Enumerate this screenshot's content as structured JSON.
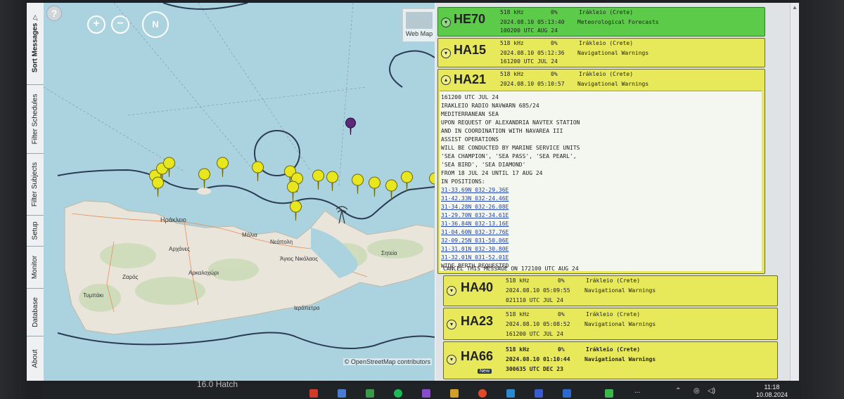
{
  "sidebar": {
    "help_label": "?",
    "tabs": [
      {
        "label": "Sort Messages"
      },
      {
        "label": "Filter Schedules"
      },
      {
        "label": "Filter Subjects"
      },
      {
        "label": "Setup"
      },
      {
        "label": "Monitor"
      },
      {
        "label": "Database"
      },
      {
        "label": "About"
      }
    ]
  },
  "map": {
    "zoom_in": "+",
    "zoom_out": "−",
    "compass": "N",
    "basemap_label": "Web Map",
    "attribution": "© OpenStreetMap contributors",
    "places": {
      "heraklion": "Ηράκλειο",
      "malia": "Μάλια",
      "neapoli": "Νεάπολη",
      "archanes": "Αρχάνες",
      "agios_nikolaos": "Άγιος Νικόλαος",
      "sitia": "Σητεία",
      "arkalochori": "Αρκαλοχώρι",
      "zaros": "Ζαρός",
      "tympaki": "Τυμπάκι",
      "ierapetra": "Ιεράπετρα"
    }
  },
  "messages": [
    {
      "id": "HE70",
      "freq": "518 kHz",
      "pct": "0%",
      "station": "Irákleio (Crete)",
      "datetime": "2024.08.10 05:13:40",
      "subject": "Meteorological Forecasts",
      "ref": "100200 UTC AUG 24",
      "color": "#5dcb4a",
      "expanded": false
    },
    {
      "id": "HA15",
      "freq": "518 kHz",
      "pct": "0%",
      "station": "Irákleio (Crete)",
      "datetime": "2024.08.10 05:12:36",
      "subject": "Navigational Warnings",
      "ref": "161200 UTC JUL 24",
      "color": "#e7e85a",
      "expanded": false
    },
    {
      "id": "HA21",
      "freq": "518 kHz",
      "pct": "0%",
      "station": "Irákleio (Crete)",
      "datetime": "2024.08.10 05:10:57",
      "subject": "Navigational Warnings",
      "ref": "",
      "color": "#e7e85a",
      "expanded": true
    },
    {
      "id": "HA40",
      "freq": "518 kHz",
      "pct": "0%",
      "station": "Irákleio (Crete)",
      "datetime": "2024.08.10 05:09:55",
      "subject": "Navigational Warnings",
      "ref": "021110 UTC JUL 24",
      "color": "#e7e85a",
      "expanded": false
    },
    {
      "id": "HA23",
      "freq": "518 kHz",
      "pct": "0%",
      "station": "Irákleio (Crete)",
      "datetime": "2024.08.10 05:08:52",
      "subject": "Navigational Warnings",
      "ref": "161200 UTC JUL 24",
      "color": "#e7e85a",
      "expanded": false
    },
    {
      "id": "HA66",
      "freq": "518 kHz",
      "pct": "0%",
      "station": "Irákleio (Crete)",
      "datetime": "2024.08.10 01:10:44",
      "subject": "Navigational Warnings",
      "ref": "300635 UTC DEC 23",
      "color": "#e7e85a",
      "expanded": false,
      "badge": "New"
    }
  ],
  "expanded_body": {
    "lines": [
      "161200 UTC JUL 24",
      "IRAKLEIO RADIO NAVWARN 685/24",
      "MEDITERRANEAN SEA",
      "UPON REQUEST OF ALEXANDRIA NAVTEX STATION",
      "AND IN COORDINATION WITH NAVAREA III",
      "ASSIST OPERATIONS",
      "WILL BE CONDUCTED BY MARINE SERVICE UNITS",
      "'SEA CHAMPION', 'SEA PASS', 'SEA PEARL',",
      "'SEA BIRD', 'SEA DIAMOND'",
      "FROM 18 JUL 24 UNTIL 17 AUG 24",
      "IN POSITIONS:"
    ],
    "positions": [
      "31-33.69N 032-29.36E",
      "31-42.33N 032-24.46E",
      "31-34.28N 032-26.08E",
      "31-29.70N 032-34.61E",
      "31-36.84N 032-13.16E",
      "31-04.60N 032-37.76E",
      "32-09.25N 031-50.06E",
      "31-31.01N 032-30.80E",
      "31-32.01N 031-52.01E"
    ],
    "closing": [
      "WIDE BERTH REQUESTED",
      "CANCEL THIS MESSAGE ON 172100 UTC AUG 24"
    ]
  },
  "taskbar": {
    "time": "11:18",
    "date": "10.08.2024",
    "more": "...",
    "hidden_text": "16.0  Hatch"
  }
}
